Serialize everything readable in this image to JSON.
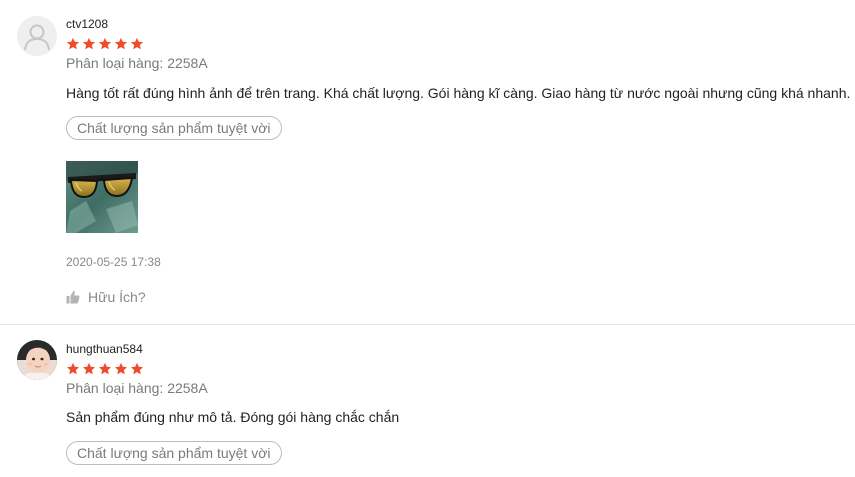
{
  "colors": {
    "star": "#ee4d2d",
    "divider": "#e8e8e8",
    "muted_text": "#7a7a7a"
  },
  "reviews": [
    {
      "username": "ctv1208",
      "rating": 5,
      "rating_max": 5,
      "variation": "Phân loại hàng: 2258A",
      "comment": "Hàng tốt rất đúng hình ảnh để trên trang. Khá chất lượng. Gói hàng kĩ càng. Giao hàng từ nước ngoài nhưng cũng khá nhanh.",
      "tag": "Chất lượng sản phẩm tuyệt vời",
      "timestamp": "2020-05-25 17:38",
      "helpful_label": "Hữu Ích?",
      "avatar_icon": "default-user-icon",
      "photo_icon": "sunglasses-photo"
    },
    {
      "username": "hungthuan584",
      "rating": 5,
      "rating_max": 5,
      "variation": "Phân loại hàng: 2258A",
      "comment": "Sản phẩm đúng như mô tả. Đóng gói hàng chắc chắn",
      "tag": "Chất lượng sản phẩm tuyệt vời",
      "avatar_icon": "user-photo-avatar"
    }
  ]
}
